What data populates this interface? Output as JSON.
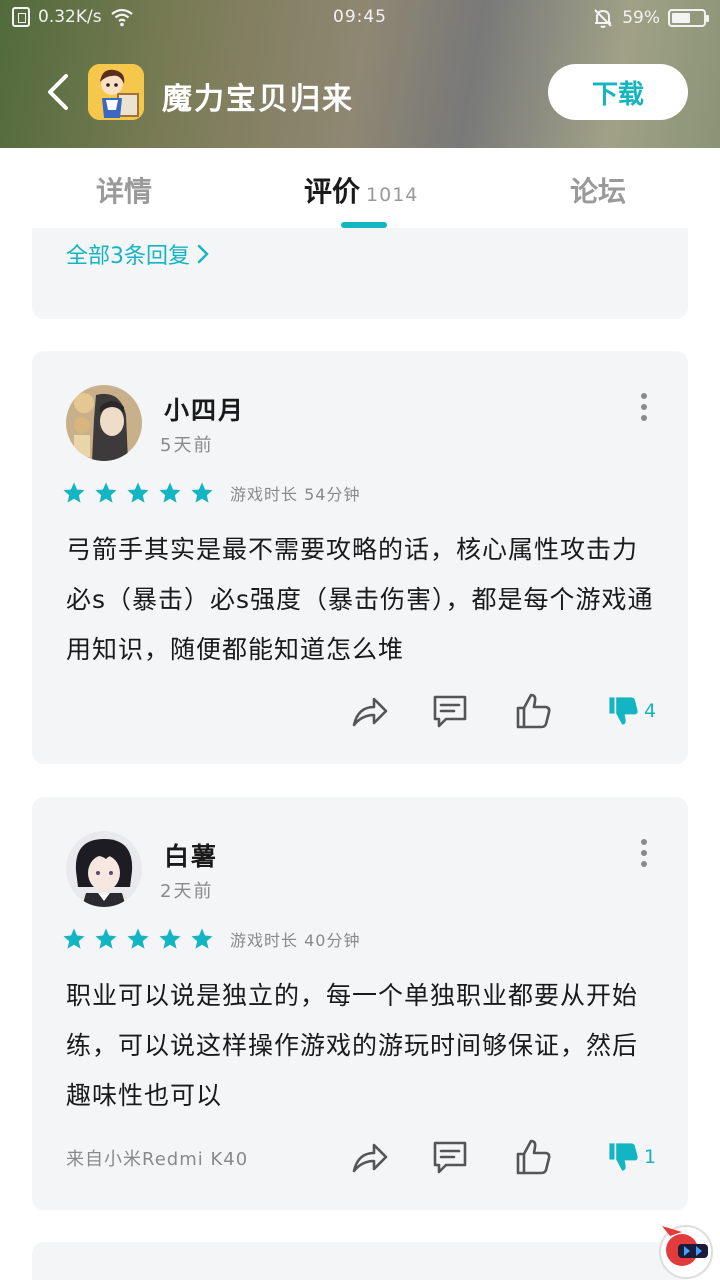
{
  "status_bar": {
    "net_speed": "0.32K/s",
    "time": "09:45",
    "battery": "59%",
    "battery_level": 0.59
  },
  "app": {
    "title": "魔力宝贝归来",
    "download_label": "下载"
  },
  "tabs": [
    {
      "label": "详情"
    },
    {
      "label": "评价",
      "count": "1014"
    },
    {
      "label": "论坛"
    }
  ],
  "partial_card": {
    "all_replies": "全部3条回复"
  },
  "reviews": [
    {
      "user": "小四月",
      "time": "5天前",
      "rating": 5,
      "playtime": "游戏时长 54分钟",
      "text": "弓箭手其实是最不需要攻略的话，核心属性攻击力必s（暴击）必s强度（暴击伤害），都是每个游戏通用知识，随便都能知道怎么堆",
      "device": "",
      "dislikes": "4"
    },
    {
      "user": "白薯",
      "time": "2天前",
      "rating": 5,
      "playtime": "游戏时长 40分钟",
      "text": "职业可以说是独立的，每一个单独职业都要从开始练，可以说这样操作游戏的游玩时间够保证，然后趣味性也可以",
      "device": "来自小米Redmi K40",
      "dislikes": "1"
    }
  ],
  "colors": {
    "accent": "#14b5c2",
    "card_bg": "#f4f5f7",
    "muted": "#8a8a8a"
  },
  "icons": [
    "back-arrow-icon",
    "wifi-icon",
    "bell-muted-icon",
    "battery-icon",
    "star-icon",
    "share-icon",
    "comment-icon",
    "thumbs-up-icon",
    "thumbs-down-icon",
    "more-vertical-icon",
    "chevron-right-icon"
  ]
}
